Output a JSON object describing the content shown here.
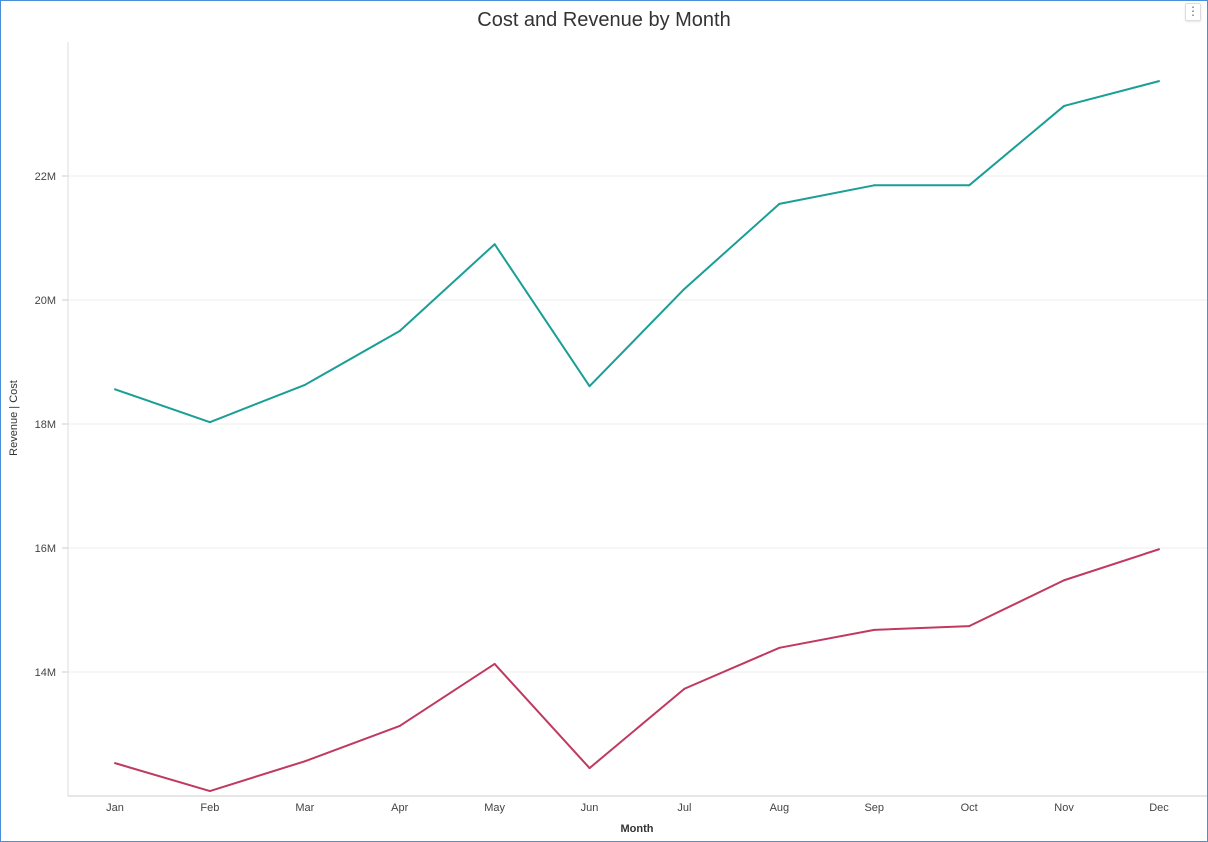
{
  "chart_data": {
    "type": "line",
    "title": "Cost and Revenue by Month",
    "xlabel": "Month",
    "ylabel": "Revenue  |  Cost",
    "categories": [
      "Jan",
      "Feb",
      "Mar",
      "Apr",
      "May",
      "Jun",
      "Jul",
      "Aug",
      "Sep",
      "Oct",
      "Nov",
      "Dec"
    ],
    "yticks": [
      14,
      16,
      18,
      20,
      22
    ],
    "ytick_labels": [
      "14M",
      "16M",
      "18M",
      "20M",
      "22M"
    ],
    "ylim": [
      12,
      24.2
    ],
    "grid": true,
    "series": [
      {
        "color": "#1a9e96",
        "values": [
          18.56,
          18.03,
          18.63,
          19.5,
          20.9,
          18.61,
          20.18,
          21.55,
          21.85,
          21.85,
          23.13,
          23.53
        ]
      },
      {
        "color": "#c0395f",
        "values": [
          12.53,
          12.08,
          12.56,
          13.13,
          14.13,
          12.45,
          13.73,
          14.39,
          14.68,
          14.74,
          15.48,
          15.98
        ]
      }
    ]
  },
  "menu": {
    "icon": "more-vertical-icon",
    "label": "⋮"
  }
}
